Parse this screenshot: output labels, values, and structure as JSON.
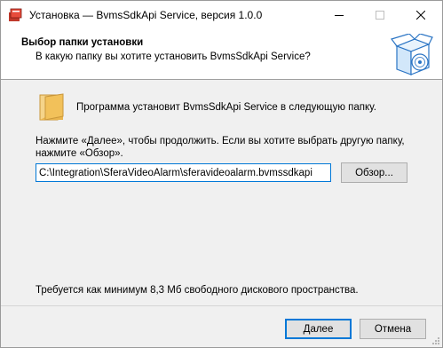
{
  "window": {
    "title": "Установка — BvmsSdkApi Service, версия 1.0.0",
    "minimize_icon": "minimize-icon",
    "maximize_icon": "maximize-icon",
    "close_icon": "close-icon"
  },
  "header": {
    "title": "Выбор папки установки",
    "subtitle": "В какую папку вы хотите установить BvmsSdkApi Service?"
  },
  "main": {
    "intro": "Программа установит BvmsSdkApi Service в следующую папку.",
    "instruction_line1": "Нажмите «Далее», чтобы продолжить. Если вы хотите выбрать другую папку,",
    "instruction_line2": "нажмите «Обзор».",
    "path_value": "C:\\Integration\\SferaVideoAlarm\\sferavideoalarm.bvmssdkapi",
    "browse_label": "Обзор...",
    "space_required": "Требуется как минимум 8,3 Мб свободного дискового пространства."
  },
  "footer": {
    "next_label": "Далее",
    "cancel_label": "Отмена"
  },
  "colors": {
    "accent": "#0078d7",
    "folder": "#f2c15a"
  }
}
